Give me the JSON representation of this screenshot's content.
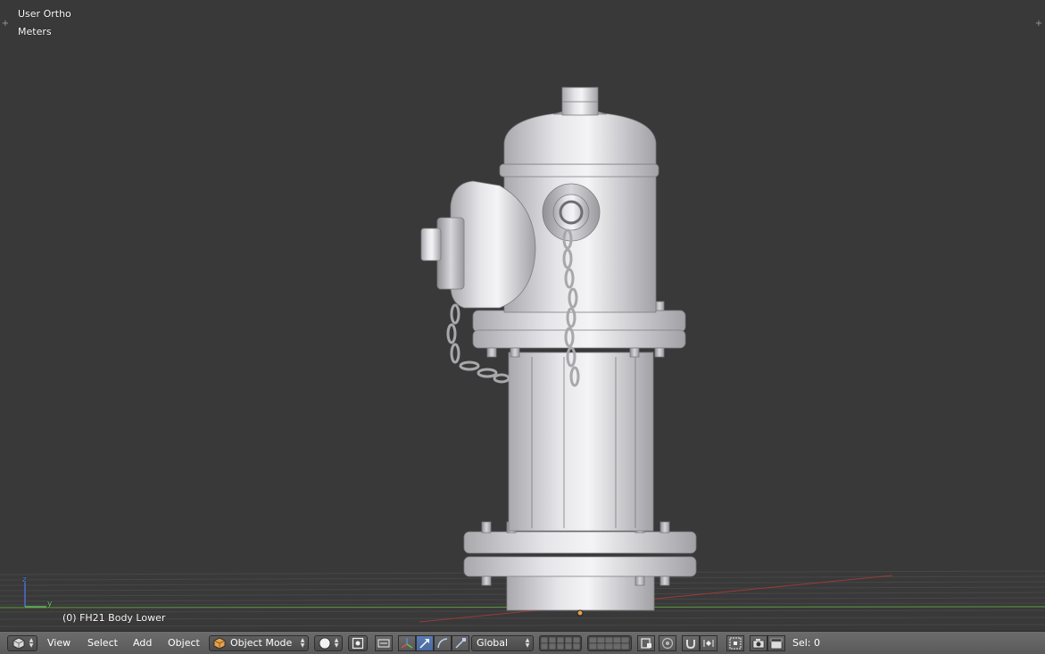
{
  "viewport": {
    "view_label": "User Ortho",
    "units_label": "Meters",
    "object_info": "(0) FH21 Body Lower",
    "axis": {
      "z": "z",
      "y": "y"
    }
  },
  "header": {
    "menu": {
      "view": "View",
      "select": "Select",
      "add": "Add",
      "object": "Object"
    },
    "mode": "Object Mode",
    "orientation": "Global",
    "status": "Sel: 0"
  },
  "colors": {
    "viewport_bg": "#393939",
    "header_bg": "#5e5e5e",
    "active_button": "#5680c2",
    "x_axis": "#d24b4b",
    "y_axis": "#6bb040"
  }
}
